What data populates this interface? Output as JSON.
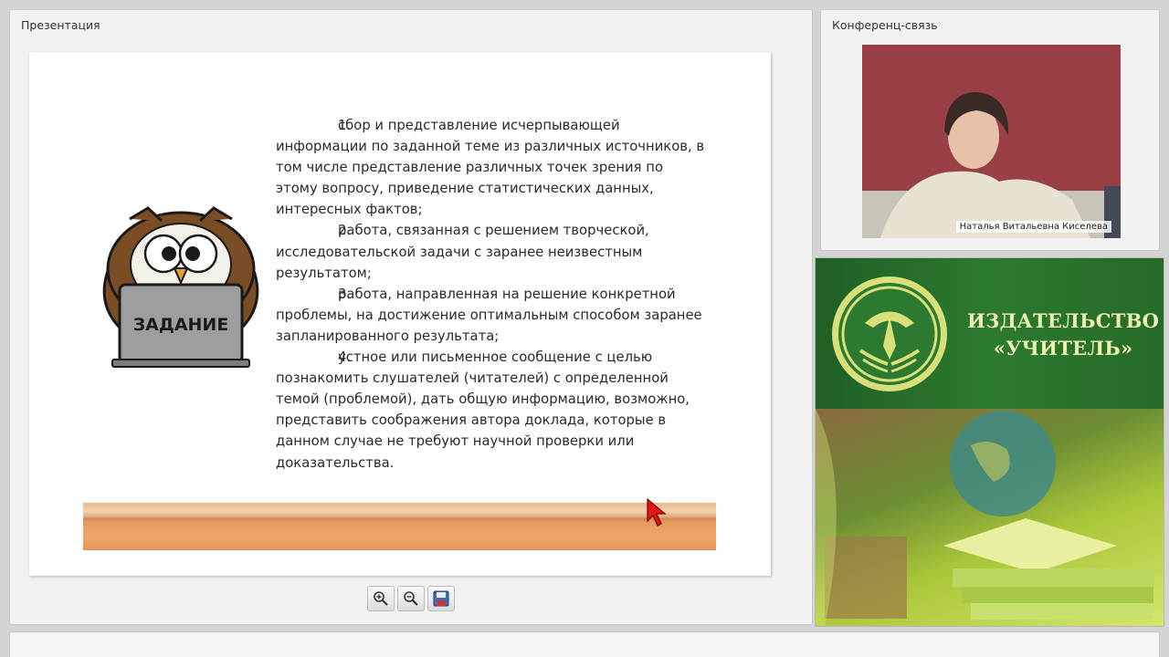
{
  "presentation_panel": {
    "title": "Презентация"
  },
  "slide": {
    "owl_label": "ЗАДАНИЕ",
    "items": [
      {
        "num": "1.",
        "text": "сбор и представление исчерпывающей информации по заданной теме из различных источников, в том числе представление различных точек зрения по этому вопросу, приведение статистических данных, интересных фактов;"
      },
      {
        "num": "2.",
        "text": "работа, связанная с решением творческой, исследовательской задачи с заранее неизвестным результатом;"
      },
      {
        "num": "3.",
        "text": "работа, направленная на решение конкретной проблемы, на достижение оптимальным способом заранее запланированного результата;"
      },
      {
        "num": "4.",
        "text": "устное или письменное сообщение с целью познакомить слушателей (читателей) с определенной темой (проблемой), дать общую информацию, возможно, представить соображения автора доклада, которые в данном случае не требуют научной проверки или доказательства."
      }
    ]
  },
  "toolbar": {
    "buttons": [
      "zoom-in-icon",
      "zoom-out-icon",
      "save-icon"
    ]
  },
  "conference_panel": {
    "title": "Конференц-связь",
    "participant_name": "Наталья Витальевна Киселева"
  },
  "ad_banner": {
    "line1": "ИЗДАТЕЛЬСТВО",
    "line2": "«УЧИТЕЛЬ»",
    "colors": {
      "green": "#2c7a2f",
      "text": "#eef0b0"
    }
  }
}
